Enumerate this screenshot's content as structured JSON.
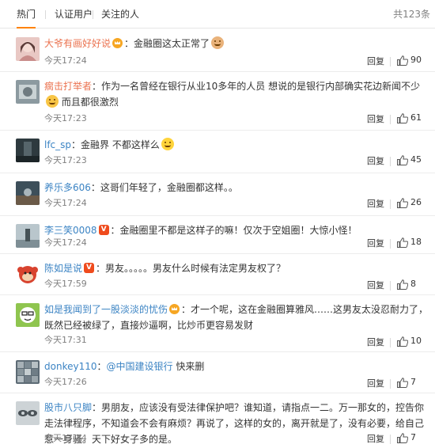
{
  "tabs": [
    {
      "label": "热门",
      "active": true
    },
    {
      "label": "认证用户",
      "active": false
    },
    {
      "label": "关注的人",
      "active": false
    }
  ],
  "total_label": "共123条",
  "reply_label": "回复",
  "colors": {
    "nick": "#eb7350",
    "accent": "#ff8200",
    "link": "#3c84c4",
    "muted": "#808080"
  },
  "comments": [
    {
      "nick": "大爷有画好好说",
      "badge": "crown",
      "text": "：金融圈这太正常了",
      "emoji": "cat-emoji",
      "time": "今天17:24",
      "likes": "90"
    },
    {
      "nick": "瘸击打举者",
      "badge": "",
      "text": "：作为一名曾经在银行从业10多年的人员 想说的是银行内部确实花边新闻不少",
      "emoji": "smile-emoji",
      "text2": " 而且都很激烈",
      "time": "今天17:23",
      "likes": "61"
    },
    {
      "nick": "lfc_sp",
      "badge": "",
      "text": "：金融界 不都这样么",
      "emoji": "laugh-emoji",
      "time": "今天17:23",
      "likes": "45"
    },
    {
      "nick": "养乐多606",
      "badge": "",
      "text": "：这哥们年轻了，金融圈都这样。。",
      "emoji": "",
      "time": "今天17:24",
      "likes": "26"
    },
    {
      "nick": "李三笑0008",
      "badge": "v",
      "text": "：金融圈里不都是这样子的嘛！仅次于空姐圈！大惊小怪！",
      "emoji": "",
      "time": "今天17:24",
      "likes": "18"
    },
    {
      "nick": "陈如是说",
      "badge": "v",
      "text": "：男友。。。。。男友什么时候有法定男友权了？",
      "emoji": "",
      "time": "今天17:59",
      "likes": "8"
    },
    {
      "nick": "如是我闻到了一股淡淡的忧伤",
      "badge": "crown",
      "text": "：才一个呢，这在金融圈算雅风……这男友太没忍耐力了，既然已经被绿了，直接炒逼啊，比炒币更容易发财",
      "emoji": "",
      "time": "今天17:31",
      "likes": "10"
    },
    {
      "nick": "donkey110",
      "badge": "",
      "mention": "@中国建设银行",
      "text": " 快来删",
      "emoji": "",
      "time": "今天17:26",
      "likes": "7"
    },
    {
      "nick": "股市八只脚",
      "badge": "",
      "text": "：男朋友，应该没有受法律保护吧？谁知道，请指点一二。万一那女的，控告你走法律程序，不知道会不会有麻烦？再说了，这样的女的，离开就是了，没有必要，给自己惹一身骚。天下好女子多的是。",
      "emoji": "",
      "time": "今天17:44",
      "likes": "7"
    }
  ]
}
